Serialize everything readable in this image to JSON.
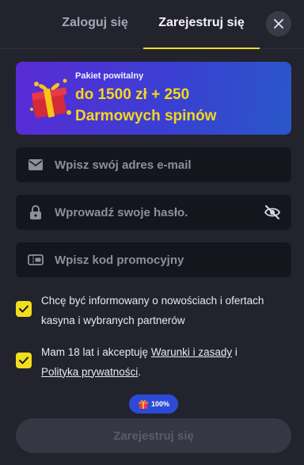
{
  "tabs": {
    "login_label": "Zaloguj się",
    "register_label": "Zarejestruj się",
    "active": "register"
  },
  "banner": {
    "small_text": "Pakiet powitalny",
    "line1": "do 1500 zł + 250",
    "line2": "Darmowych spinów",
    "icon": "gift-icon"
  },
  "form": {
    "email_placeholder": "Wpisz swój adres e-mail",
    "email_icon": "envelope-icon",
    "password_placeholder": "Wprowadź swoje hasło.",
    "password_icon": "lock-icon",
    "password_toggle_icon": "eye-off-icon",
    "promo_placeholder": "Wpisz kod promocyjny",
    "promo_icon": "ticket-icon"
  },
  "consent": {
    "newsletter_text": "Chcę być informowany o nowościach i ofertach kasyna i wybranych partnerów",
    "newsletter_checked": true,
    "terms_prefix": "Mam 18 lat i akceptuję ",
    "terms_link": "Warunki i zasady",
    "terms_middle": " i ",
    "privacy_link": "Polityka prywatności",
    "terms_suffix": ".",
    "terms_checked": true
  },
  "progress": {
    "label": "100%",
    "icon": "gift-icon"
  },
  "submit": {
    "label": "Zarejestruj się",
    "disabled": true
  },
  "colors": {
    "background": "#23232e",
    "field": "#15151d",
    "accent_yellow": "#f2de1c",
    "badge_blue": "#2b4bd6",
    "button_disabled": "#373743"
  }
}
